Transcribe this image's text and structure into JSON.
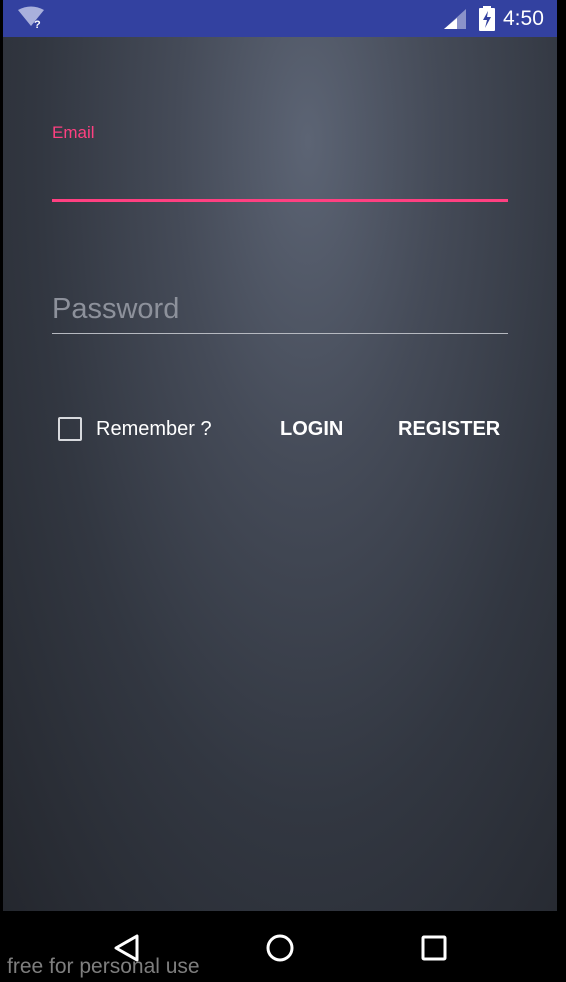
{
  "status_bar": {
    "time": "4:50",
    "wifi_icon": "wifi-unknown-icon",
    "signal_icon": "cell-signal-icon",
    "battery_icon": "battery-charging-icon",
    "bar_color": "#3341a0"
  },
  "login_form": {
    "email": {
      "label": "Email",
      "value": ""
    },
    "password": {
      "placeholder": "Password",
      "value": ""
    },
    "remember": {
      "label": "Remember ?",
      "checked": false
    },
    "login_label": "LOGIN",
    "register_label": "REGISTER",
    "accent_color": "#ff4081"
  },
  "nav_bar": {
    "back_icon": "back-triangle-icon",
    "home_icon": "home-circle-icon",
    "recents_icon": "recents-square-icon"
  },
  "watermark": "free for personal use"
}
